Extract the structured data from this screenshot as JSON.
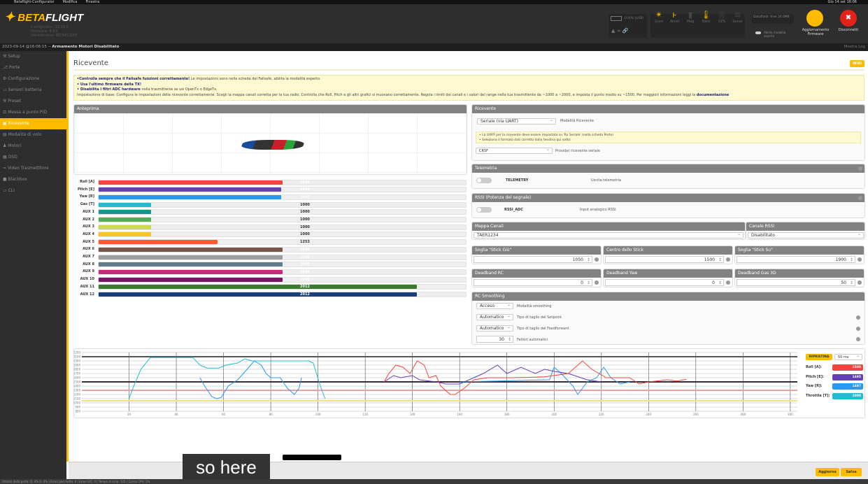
{
  "os_menu": [
    "Betaflight-Configurator",
    "Modifica",
    "Finestra"
  ],
  "os_clock": "Gio 14 set 16:06",
  "header": {
    "logo_text_a": "BETA",
    "logo_text_b": "FLIGHT",
    "logo_sub": [
      "Configurator: 10.10.0",
      "Firmware: 4.4.0",
      "Identificativo: BETAFLIGHT"
    ],
    "battery": "0.00V (USB)",
    "sensors": [
      {
        "label": "Gyro",
        "icon": "gyro-icon",
        "on": true
      },
      {
        "label": "Accel",
        "icon": "accel-icon",
        "on": true
      },
      {
        "label": "Mag",
        "icon": "mag-icon",
        "on": false
      },
      {
        "label": "Baro",
        "icon": "baro-icon",
        "on": true
      },
      {
        "label": "GPS",
        "icon": "gps-icon",
        "on": false
      },
      {
        "label": "Sonar",
        "icon": "sonar-icon",
        "on": false
      }
    ],
    "dataflash": "Dataflash: free 16.0MB",
    "expert_mode": "Abilita modalità esperto",
    "firmware_update": "Aggiornamento Firmware",
    "disconnect": "Disconnetti",
    "show_log": "Mostra Log"
  },
  "status_line": {
    "date": "2023-09-14 @16:06:15 -- ",
    "status": "Armamento Motori Disabilitato"
  },
  "sidebar": {
    "active": 6,
    "items": [
      {
        "label": "Setup",
        "icon": "wrench-icon"
      },
      {
        "label": "Porte",
        "icon": "ports-icon"
      },
      {
        "label": "Configurazione",
        "icon": "gear-icon"
      },
      {
        "label": "Sensori batteria",
        "icon": "battery-icon"
      },
      {
        "label": "Preset",
        "icon": "preset-icon"
      },
      {
        "label": "Messa a punto PID",
        "icon": "pid-icon"
      },
      {
        "label": "Ricevente",
        "icon": "receiver-icon"
      },
      {
        "label": "Modalità di volo",
        "icon": "modes-icon"
      },
      {
        "label": "Motori",
        "icon": "motor-icon"
      },
      {
        "label": "OSD",
        "icon": "osd-icon"
      },
      {
        "label": "Video Trasmettitore",
        "icon": "vtx-icon"
      },
      {
        "label": "Blackbox",
        "icon": "blackbox-icon"
      },
      {
        "label": "CLI",
        "icon": "cli-icon"
      }
    ]
  },
  "page": {
    "title": "Ricevente",
    "wiki": "WIKI",
    "note": {
      "l1b": "•Controlla sempre che il Failsafe funzioni correttamente!",
      "l1": " Le impostazioni sono nella scheda del Failsafe, abilita la modalità esperto.",
      "l2b": "• Usa l'ultimo firmware della TX!",
      "l3b": "• Disabilita i filtri ADC hardware",
      "l3": " nella trasmittente se usi OpenTx o EdgeTx.",
      "l4": "Impostazione di base: Configura le impostazioni della ricevente correttamente. Scegli la mappa canali corretta per la tua radio. Controlla che Roll, Pitch e gli altri grafici si muovano correttamente. Regola i limiti dei canali e i valori del range nella tua trasmittente da ~1000 a ~2000, e imposta il punto medio su ~1500. Per maggiori informazioni leggi la ",
      "l4link": "documentazione"
    }
  },
  "preview": {
    "title": "Anteprima"
  },
  "channels": {
    "min": 800,
    "max": 2200,
    "items": [
      {
        "label": "Roll [A]",
        "value": 1500,
        "color": "#f1453d"
      },
      {
        "label": "Pitch [E]",
        "value": 1495,
        "color": "#673fb4"
      },
      {
        "label": "Yaw [R]",
        "value": 1497,
        "color": "#2b98f0"
      },
      {
        "label": "Gas [T]",
        "value": 1000,
        "color": "#1fbcd2"
      },
      {
        "label": "AUX 1",
        "value": 1000,
        "color": "#159588"
      },
      {
        "label": "AUX 2",
        "value": 1000,
        "color": "#50ae55"
      },
      {
        "label": "AUX 3",
        "value": 1000,
        "color": "#cdda49"
      },
      {
        "label": "AUX 4",
        "value": 1000,
        "color": "#fdc02f"
      },
      {
        "label": "AUX 5",
        "value": 1253,
        "color": "#fc5830"
      },
      {
        "label": "AUX 6",
        "value": 1500,
        "color": "#785549"
      },
      {
        "label": "AUX 7",
        "value": 1500,
        "color": "#9e9e9e"
      },
      {
        "label": "AUX 8",
        "value": 1500,
        "color": "#617d8a"
      },
      {
        "label": "AUX 9",
        "value": 1500,
        "color": "#cf267d"
      },
      {
        "label": "AUX 10",
        "value": 1500,
        "color": "#7a1464"
      },
      {
        "label": "AUX 11",
        "value": 2012,
        "color": "#3b7a2f"
      },
      {
        "label": "AUX 12",
        "value": 2012,
        "color": "#1a3f7a"
      }
    ]
  },
  "receiver": {
    "title": "Ricevente",
    "mode": "Seriale (via UART)",
    "mode_label": "Modalità Ricevente",
    "note1": "• La UART per la ricevente deve essere impostata su 'Rx Seriale' (nella scheda Porte)",
    "note2": "• Seleziona il formato dati corretto dalla tendina qui sotto:",
    "provider": "CRSF",
    "provider_label": "Provider ricevente seriale"
  },
  "telemetry": {
    "title": "Telemetria",
    "name": "TELEMETRY",
    "desc": "Uscita telemetria",
    "enabled": false
  },
  "rssi": {
    "title": "RSSI (Potenza del segnale)",
    "name": "RSSI_ADC",
    "desc": "Input analogico RSSI",
    "enabled": false
  },
  "channel_map": {
    "title": "Mappa Canali",
    "value": "TAER1234",
    "rssi_title": "Canale RSSI",
    "rssi_value": "Disabilitato"
  },
  "sticks": {
    "low_title": "Soglia \"Stick Giù\"",
    "low": "1050",
    "center_title": "Centro dello Stick",
    "center": "1500",
    "high_title": "Soglia \"Stick Su\"",
    "high": "1900"
  },
  "deadband": {
    "rc_title": "Deadband RC",
    "rc": "0",
    "yaw_title": "Deadband Yaw",
    "yaw": "0",
    "gas_title": "Deadband Gas 3D",
    "gas": "50"
  },
  "smoothing": {
    "title": "RC Smoothing",
    "mode": "Acceso",
    "mode_label": "Modalità smoothing",
    "setpoint": "Automatico",
    "setpoint_label": "Tipo di taglio del Setpoint",
    "ff": "Automatico",
    "ff_label": "Tipo di taglio del Feedforward",
    "factor": "30",
    "factor_label": "Fattori automatici"
  },
  "graph_controls": {
    "reset": "RIPRISTINA",
    "rate": "50 ms",
    "legend": [
      {
        "label": "Roll [A]:",
        "value": "1500",
        "color": "#f1453d"
      },
      {
        "label": "Pitch [E]:",
        "value": "1495",
        "color": "#673fb4"
      },
      {
        "label": "Yaw [R]:",
        "value": "1497",
        "color": "#2b98f0"
      },
      {
        "label": "Throttle [T]:",
        "value": "1000",
        "color": "#1fbcd2"
      }
    ]
  },
  "chart_data": {
    "type": "line",
    "xlim": [
      0,
      303
    ],
    "ylim": [
      800,
      2200
    ],
    "xticks": [
      20,
      40,
      60,
      80,
      100,
      120,
      140,
      160,
      180,
      200,
      220,
      240,
      260,
      280,
      300
    ],
    "yticks": [
      2200,
      2100,
      2000,
      1900,
      1800,
      1700,
      1600,
      1500,
      1400,
      1300,
      1200,
      1100,
      1000,
      900,
      800
    ],
    "grid": true,
    "series": [
      {
        "color": "#f1453d",
        "points": [
          [
            128,
            1500
          ],
          [
            130,
            1700
          ],
          [
            133,
            1900
          ],
          [
            136,
            1850
          ],
          [
            139,
            1700
          ],
          [
            142,
            2000
          ],
          [
            145,
            1900
          ],
          [
            147,
            1600
          ],
          [
            150,
            1650
          ],
          [
            152,
            1400
          ],
          [
            156,
            1200
          ],
          [
            158,
            1200
          ],
          [
            162,
            1350
          ],
          [
            166,
            1550
          ],
          [
            172,
            1600
          ],
          [
            182,
            1600
          ],
          [
            196,
            1620
          ],
          [
            206,
            1700
          ],
          [
            212,
            2000
          ],
          [
            216,
            1800
          ],
          [
            222,
            1600
          ],
          [
            232,
            1600
          ],
          [
            236,
            1450
          ],
          [
            240,
            1500
          ],
          [
            248,
            1550
          ],
          [
            252,
            1520
          ],
          [
            256,
            1560
          ]
        ]
      },
      {
        "color": "#673fb4",
        "points": [
          [
            128,
            1500
          ],
          [
            132,
            1650
          ],
          [
            135,
            1600
          ],
          [
            140,
            1650
          ],
          [
            143,
            1550
          ],
          [
            150,
            1500
          ],
          [
            154,
            1450
          ],
          [
            160,
            1450
          ],
          [
            166,
            1600
          ],
          [
            170,
            1700
          ],
          [
            176,
            1900
          ],
          [
            180,
            1700
          ],
          [
            186,
            1850
          ],
          [
            192,
            1700
          ],
          [
            196,
            1800
          ],
          [
            200,
            1750
          ],
          [
            206,
            1700
          ],
          [
            214,
            1550
          ],
          [
            220,
            1500
          ]
        ]
      },
      {
        "color": "#2b98f0",
        "points": [
          [
            50,
            1600
          ],
          [
            52,
            1400
          ],
          [
            55,
            1150
          ],
          [
            57,
            1100
          ],
          [
            59,
            1130
          ],
          [
            62,
            1400
          ],
          [
            66,
            1550
          ],
          [
            70,
            1800
          ],
          [
            73,
            2000
          ],
          [
            76,
            1900
          ],
          [
            78,
            1700
          ],
          [
            80,
            1600
          ],
          [
            84,
            1600
          ],
          [
            87,
            1350
          ],
          [
            90,
            1200
          ],
          [
            92,
            1350
          ],
          [
            93,
            1600
          ],
          [
            160,
            1500
          ],
          [
            198,
            1550
          ],
          [
            200,
            1850
          ],
          [
            203,
            1700
          ],
          [
            208,
            1400
          ],
          [
            210,
            1200
          ],
          [
            214,
            1500
          ],
          [
            218,
            1600
          ],
          [
            221,
            1850
          ],
          [
            224,
            1600
          ],
          [
            228,
            1450
          ],
          [
            232,
            1500
          ]
        ]
      },
      {
        "color": "#1fbcd2",
        "points": [
          [
            20,
            1100
          ],
          [
            22,
            1400
          ],
          [
            25,
            1800
          ],
          [
            29,
            2080
          ],
          [
            47,
            2080
          ],
          [
            50,
            1900
          ],
          [
            53,
            1830
          ],
          [
            58,
            1830
          ],
          [
            61,
            1900
          ],
          [
            66,
            1950
          ],
          [
            69,
            2050
          ],
          [
            72,
            2000
          ],
          [
            80,
            2000
          ],
          [
            96,
            2000
          ],
          [
            98,
            1950
          ],
          [
            101,
            1400
          ],
          [
            103,
            1100
          ]
        ]
      },
      {
        "color": "#555555",
        "points": [
          [
            0,
            2100
          ],
          [
            303,
            2100
          ]
        ]
      },
      {
        "color": "#3a2a3a",
        "points": [
          [
            0,
            1500
          ],
          [
            303,
            1500
          ]
        ]
      },
      {
        "color": "#e8a0a0",
        "points": [
          [
            0,
            1300
          ],
          [
            303,
            1300
          ]
        ]
      },
      {
        "color": "#f3e27a",
        "points": [
          [
            0,
            1050
          ],
          [
            303,
            1050
          ]
        ]
      }
    ]
  },
  "bottom": {
    "refresh": "Aggiorna",
    "save": "Salva"
  },
  "subtitle": "so here",
  "footer": "Utilizzo della porta: D: 0% U: 0% | Errori pacchetto: 0 | Errori I2C: 0 | Tempo di ciclo: 125 | Carico CPU: 1%"
}
